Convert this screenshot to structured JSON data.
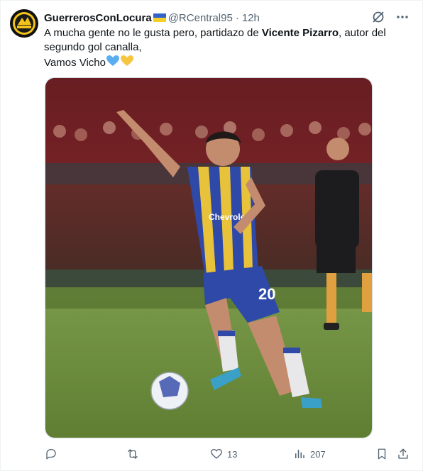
{
  "tweet": {
    "display_name": "GuerrerosConLocura",
    "handle": "@RCentral95",
    "separator": "·",
    "time": "12h",
    "text_part1": "A mucha gente no le gusta pero, partidazo de ",
    "text_bold": "Vicente Pizarro",
    "text_part2": ", autor del segundo gol canalla,",
    "text_line2": "Vamos Vicho",
    "image_alt": "Football player in blue and yellow striped kit with number 20 dribbling the ball",
    "player_number": "20",
    "sponsor_text": "Chevrolet"
  },
  "actions": {
    "reply_count": "",
    "retweet_count": "",
    "like_count": "13",
    "views_count": "207"
  },
  "colors": {
    "kit_blue": "#2f49a8",
    "kit_yellow": "#e8c23a",
    "pitch_green": "#6f8f3c",
    "icon_gray": "#536471"
  },
  "icons": {
    "avatar": "club-logo-avatar",
    "flag": "ukraine-flag-icon",
    "grok": "grok-icon",
    "more": "more-icon",
    "hearts": [
      "blue-heart-icon",
      "yellow-heart-icon"
    ],
    "reply": "reply-icon",
    "retweet": "retweet-icon",
    "like": "like-icon",
    "views": "views-icon",
    "bookmark": "bookmark-icon",
    "share": "share-icon"
  }
}
